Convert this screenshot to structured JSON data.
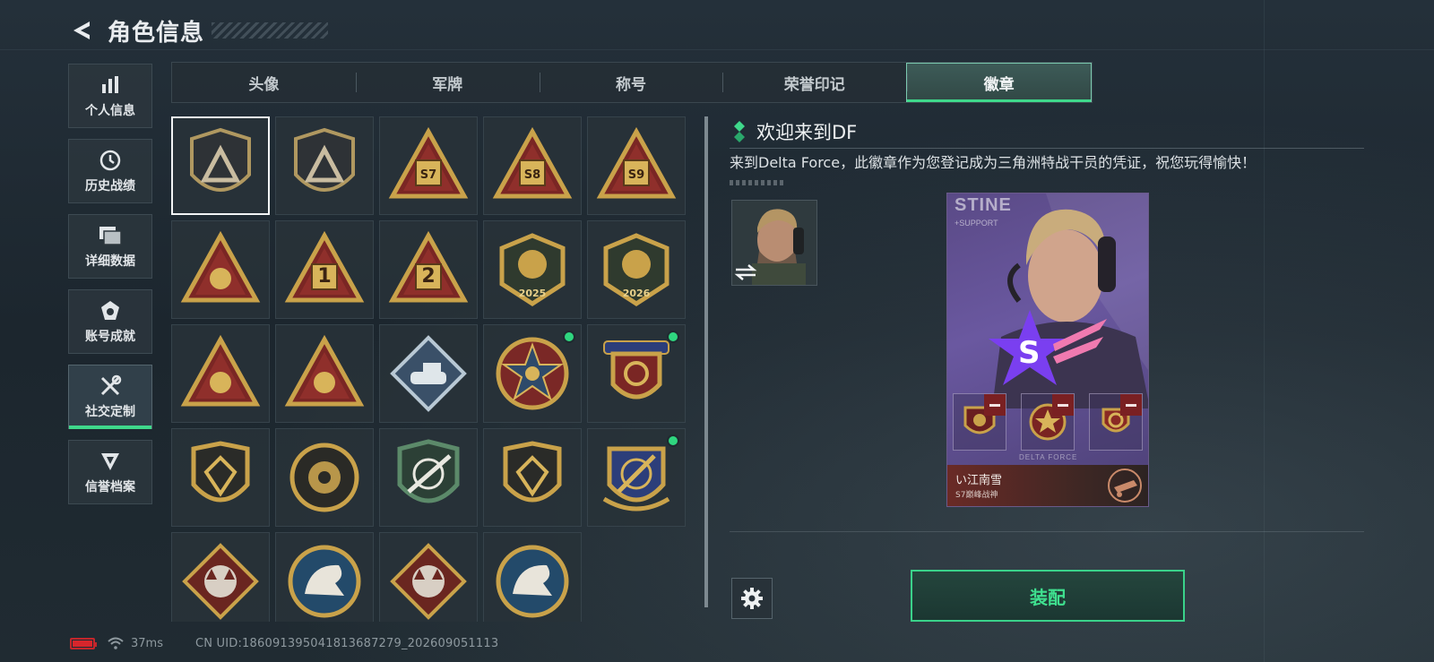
{
  "header": {
    "title": "角色信息"
  },
  "nav": [
    {
      "label": "个人信息",
      "icon": "bar-chart-icon"
    },
    {
      "label": "历史战绩",
      "icon": "clock-icon"
    },
    {
      "label": "详细数据",
      "icon": "folder-icon"
    },
    {
      "label": "账号成就",
      "icon": "medal-icon"
    },
    {
      "label": "社交定制",
      "icon": "tools-icon",
      "active": true
    },
    {
      "label": "信誉档案",
      "icon": "shield-icon"
    }
  ],
  "tabs": [
    {
      "label": "头像"
    },
    {
      "label": "军牌"
    },
    {
      "label": "称号"
    },
    {
      "label": "荣誉印记"
    },
    {
      "label": "徽章",
      "active": true
    }
  ],
  "badges": [
    {
      "id": "df-logo-badge",
      "style": "shield",
      "mark": "",
      "selected": true,
      "new": false
    },
    {
      "id": "helicopter-badge",
      "style": "shield",
      "mark": "",
      "new": false
    },
    {
      "id": "s7-badge",
      "style": "triangle",
      "mark": "S7",
      "new": false
    },
    {
      "id": "s8-badge",
      "style": "triangle",
      "mark": "S8",
      "new": false
    },
    {
      "id": "s9-badge",
      "style": "triangle",
      "mark": "S9",
      "new": false
    },
    {
      "id": "wings-badge",
      "style": "triangle",
      "mark": "",
      "new": false
    },
    {
      "id": "rank-1-badge",
      "style": "triangle",
      "mark": "1",
      "new": false
    },
    {
      "id": "rank-2-badge",
      "style": "triangle",
      "mark": "2",
      "new": false
    },
    {
      "id": "delta-force-2025-badge",
      "style": "shield-gold",
      "mark": "2025",
      "new": false
    },
    {
      "id": "delta-force-2026-badge",
      "style": "shield-gold",
      "mark": "2026",
      "new": false
    },
    {
      "id": "squad-badge",
      "style": "triangle",
      "mark": "",
      "new": false
    },
    {
      "id": "rocket-badge",
      "style": "triangle",
      "mark": "",
      "new": false
    },
    {
      "id": "tank-badge",
      "style": "diamond-blue",
      "mark": "",
      "new": false
    },
    {
      "id": "star-emblem-badge",
      "style": "round-red",
      "mark": "",
      "new": true
    },
    {
      "id": "three-star-shield-badge",
      "style": "crest",
      "mark": "",
      "new": true
    },
    {
      "id": "gem-shield-badge",
      "style": "shield-dark",
      "mark": "",
      "new": false
    },
    {
      "id": "gear-badge",
      "style": "round-dark",
      "mark": "",
      "new": false
    },
    {
      "id": "sniper-badge",
      "style": "shield-green",
      "mark": "",
      "new": false
    },
    {
      "id": "rifle-badge",
      "style": "shield-dark",
      "mark": "",
      "new": false
    },
    {
      "id": "knife-badge",
      "style": "crest-blue",
      "mark": "",
      "new": true
    },
    {
      "id": "wolf-badge",
      "style": "diamond-red",
      "mark": "",
      "new": false
    },
    {
      "id": "eagle-badge",
      "style": "round-blue",
      "mark": "",
      "new": false
    },
    {
      "id": "dragon-badge",
      "style": "diamond-red",
      "mark": "",
      "new": false
    },
    {
      "id": "lynx-badge",
      "style": "round-blue",
      "mark": "",
      "new": false
    }
  ],
  "detail": {
    "title": "欢迎来到DF",
    "description": "来到Delta Force，此徽章作为您登记成为三角洲特战干员的凭证，祝您玩得愉快！"
  },
  "card": {
    "operator_text": "STINE",
    "role_text": "+SUPPORT",
    "player_name": "い江南雪",
    "player_rank": "S7巅峰战神",
    "slot_caption": "DELTA FORCE"
  },
  "actions": {
    "equip_label": "装配"
  },
  "status": {
    "ping": "37ms",
    "uid": "CN UID:18609139504181368727​9_202609051113"
  },
  "colors": {
    "accent": "#3fd88b",
    "selected_border": "#f2f4f5",
    "new_dot": "#2fd67f",
    "gold": "#c9a24a"
  }
}
